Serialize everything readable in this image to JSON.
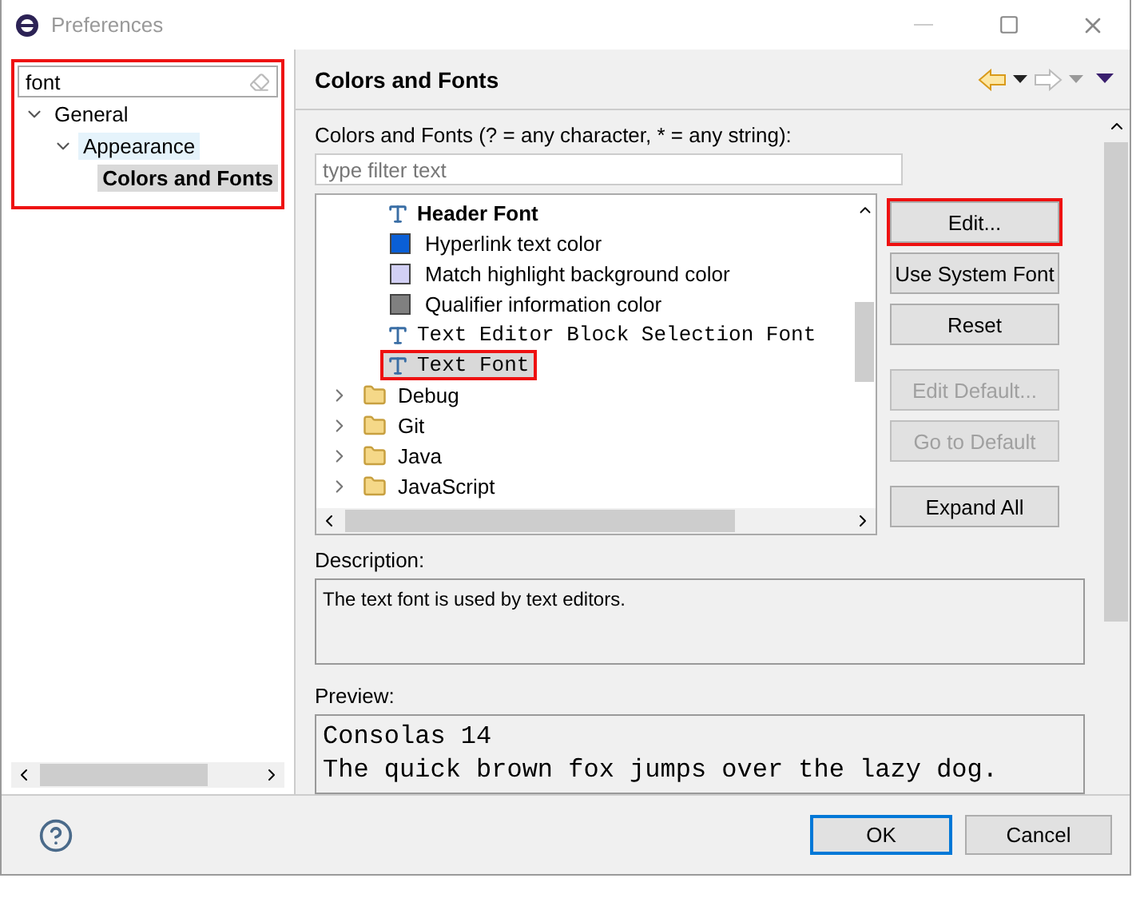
{
  "window": {
    "title": "Preferences"
  },
  "sidebar": {
    "annotated": true,
    "filter": {
      "value": "font"
    },
    "tree": [
      {
        "label": "General",
        "expanded": true,
        "selected": false,
        "hovered": false,
        "children": [
          {
            "label": "Appearance",
            "expanded": true,
            "selected": false,
            "hovered": true,
            "children": [
              {
                "label": "Colors and Fonts",
                "selected": true,
                "hovered": false
              }
            ]
          }
        ]
      }
    ]
  },
  "page": {
    "title": "Colors and Fonts",
    "filter_label": "Colors and Fonts (? = any character, * = any string):",
    "filter": {
      "placeholder": "type filter text"
    },
    "items": [
      {
        "kind": "font",
        "label": "Header Font",
        "bold": true,
        "mono": false,
        "selected": false,
        "annotated": false
      },
      {
        "kind": "color",
        "label": "Hyperlink text color",
        "color": "#0a5fd6",
        "selected": false,
        "annotated": false
      },
      {
        "kind": "color",
        "label": "Match highlight background color",
        "color": "#d2d0f4",
        "selected": false,
        "annotated": false
      },
      {
        "kind": "color",
        "label": "Qualifier information color",
        "color": "#808080",
        "selected": false,
        "annotated": false
      },
      {
        "kind": "font",
        "label": "Text Editor Block Selection Font",
        "bold": false,
        "mono": true,
        "selected": false,
        "annotated": false
      },
      {
        "kind": "font",
        "label": "Text Font",
        "bold": false,
        "mono": true,
        "selected": true,
        "annotated": true
      },
      {
        "kind": "category",
        "label": "Debug",
        "expanded": false,
        "selected": false,
        "annotated": false
      },
      {
        "kind": "category",
        "label": "Git",
        "expanded": false,
        "selected": false,
        "annotated": false
      },
      {
        "kind": "category",
        "label": "Java",
        "expanded": false,
        "selected": false,
        "annotated": false
      },
      {
        "kind": "category",
        "label": "JavaScript",
        "expanded": false,
        "selected": false,
        "annotated": false
      }
    ],
    "buttons": [
      {
        "label": "Edit...",
        "disabled": false,
        "annotated": true
      },
      {
        "label": "Use System Font",
        "disabled": false,
        "annotated": false
      },
      {
        "label": "Reset",
        "disabled": false,
        "annotated": false
      },
      {
        "label": "Edit Default...",
        "disabled": true,
        "annotated": false
      },
      {
        "label": "Go to Default",
        "disabled": true,
        "annotated": false
      },
      {
        "label": "Expand All",
        "disabled": false,
        "annotated": false
      }
    ],
    "description_label": "Description:",
    "description": "The text font is used by text editors.",
    "preview_label": "Preview:",
    "preview": [
      "Consolas 14",
      "The quick brown fox jumps over the lazy dog."
    ]
  },
  "footer": {
    "buttons": [
      {
        "label": "OK",
        "default": true
      },
      {
        "label": "Cancel",
        "default": false
      }
    ]
  }
}
